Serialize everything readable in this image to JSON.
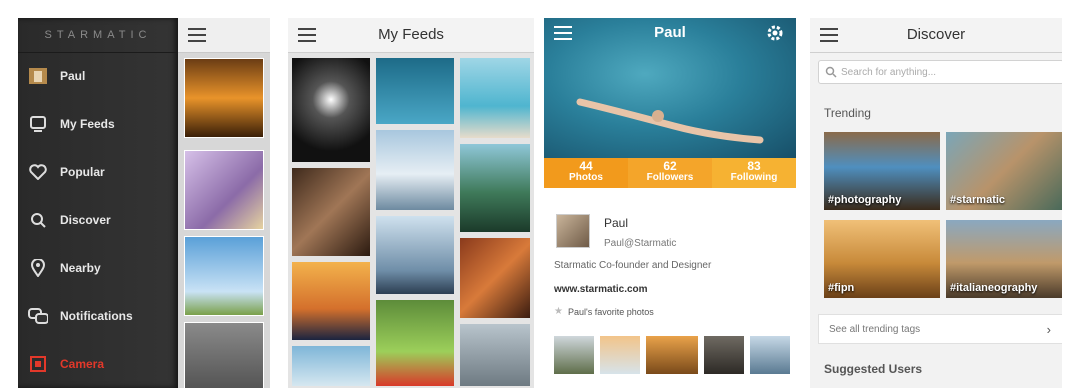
{
  "menu": {
    "brand": "STARMATIC",
    "items": [
      {
        "label": "Paul",
        "icon": "user-avatar-icon"
      },
      {
        "label": "My Feeds",
        "icon": "feeds-icon"
      },
      {
        "label": "Popular",
        "icon": "heart-icon"
      },
      {
        "label": "Discover",
        "icon": "search-icon"
      },
      {
        "label": "Nearby",
        "icon": "location-pin-icon"
      },
      {
        "label": "Notifications",
        "icon": "speech-bubbles-icon"
      },
      {
        "label": "Camera",
        "icon": "camera-icon"
      }
    ]
  },
  "feeds": {
    "title": "My Feeds"
  },
  "profile": {
    "title": "Paul",
    "stats": [
      {
        "value": "44",
        "label": "Photos"
      },
      {
        "value": "62",
        "label": "Followers"
      },
      {
        "value": "83",
        "label": "Following"
      }
    ],
    "name": "Paul",
    "handle": "Paul@Starmatic",
    "bio": "Starmatic Co-founder and Designer",
    "website": "www.starmatic.com",
    "favorites": "Paul's favorite photos"
  },
  "discover": {
    "title": "Discover",
    "search_placeholder": "Search for anything...",
    "trending_label": "Trending",
    "tags": [
      "#photography",
      "#starmatic",
      "#fipn",
      "#italianeography"
    ],
    "see_all": "See all trending tags",
    "suggested_label": "Suggested Users"
  },
  "colors": {
    "accent_orange": "#f39a1c",
    "camera_red": "#e2382a",
    "menu_bg": "#2f2f2f"
  }
}
